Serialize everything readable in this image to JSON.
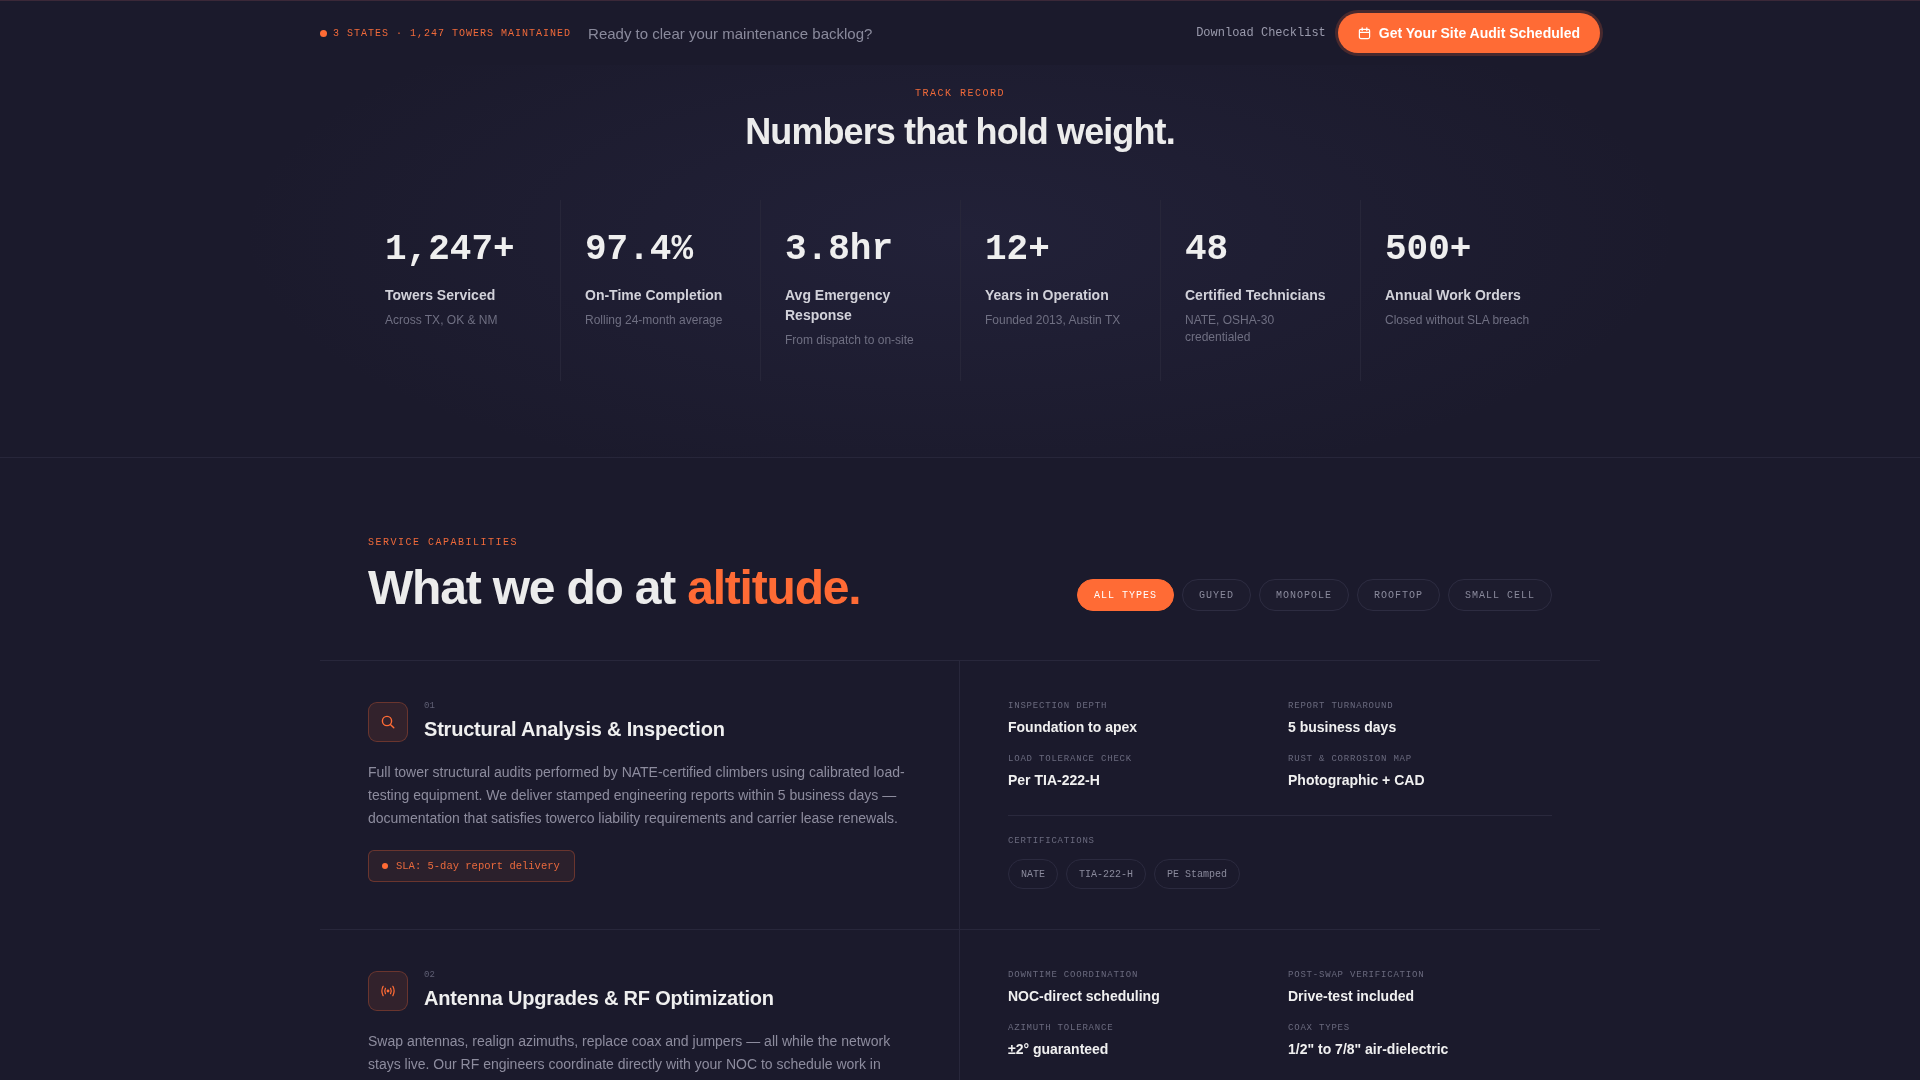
{
  "top_bar": {
    "status": "3 STATES · 1,247 TOWERS MAINTAINED",
    "tagline": "Ready to clear your maintenance backlog?",
    "download_link": "Download Checklist",
    "cta_button": "Get Your Site Audit Scheduled"
  },
  "track_record": {
    "eyebrow": "TRACK RECORD",
    "heading": "Numbers that hold weight.",
    "stats": [
      {
        "value": "1,247+",
        "label": "Towers Serviced",
        "note": "Across TX, OK & NM"
      },
      {
        "value": "97.4%",
        "label": "On-Time Completion",
        "note": "Rolling 24-month average"
      },
      {
        "value": "3.8hr",
        "label": "Avg Emergency Response",
        "note": "From dispatch to on-site"
      },
      {
        "value": "12+",
        "label": "Years in Operation",
        "note": "Founded 2013, Austin TX"
      },
      {
        "value": "48",
        "label": "Certified Technicians",
        "note": "NATE, OSHA-30 credentialed"
      },
      {
        "value": "500+",
        "label": "Annual Work Orders",
        "note": "Closed without SLA breach"
      }
    ]
  },
  "services": {
    "eyebrow": "SERVICE CAPABILITIES",
    "heading": "What we do at",
    "heading_accent": "altitude.",
    "filters": [
      {
        "label": "ALL TYPES",
        "selected": true
      },
      {
        "label": "GUYED",
        "selected": false
      },
      {
        "label": "MONOPOLE",
        "selected": false
      },
      {
        "label": "ROOFTOP",
        "selected": false
      },
      {
        "label": "SMALL CELL",
        "selected": false
      }
    ],
    "items": [
      {
        "kind": "inspection",
        "number": "01",
        "title": "Structural Analysis & Inspection",
        "description": "Full tower structural audits performed by NATE-certified climbers using calibrated load-testing equipment. We deliver stamped engineering reports within 5 business days — documentation that satisfies towerco liability requirements and carrier lease renewals.",
        "sla": "SLA: 5-day report delivery",
        "specs": [
          {
            "label": "INSPECTION DEPTH",
            "value": "Foundation to apex"
          },
          {
            "label": "REPORT TURNAROUND",
            "value": "5 business days"
          },
          {
            "label": "LOAD TOLERANCE CHECK",
            "value": "Per TIA-222-H"
          },
          {
            "label": "RUST & CORROSION MAP",
            "value": "Photographic + CAD"
          }
        ],
        "certifications_label": "CERTIFICATIONS",
        "certifications": [
          "NATE",
          "TIA-222-H",
          "PE Stamped"
        ]
      },
      {
        "kind": "antenna",
        "number": "02",
        "title": "Antenna Upgrades & RF Optimization",
        "description": "Swap antennas, realign azimuths, replace coax and jumpers — all while the network stays live. Our RF engineers coordinate directly with your NOC to schedule work in",
        "specs": [
          {
            "label": "DOWNTIME COORDINATION",
            "value": "NOC-direct scheduling"
          },
          {
            "label": "POST-SWAP VERIFICATION",
            "value": "Drive-test included"
          },
          {
            "label": "AZIMUTH TOLERANCE",
            "value": "±2° guaranteed"
          },
          {
            "label": "COAX TYPES",
            "value": "1/2\" to 7/8\" air-dielectric"
          }
        ]
      }
    ]
  }
}
